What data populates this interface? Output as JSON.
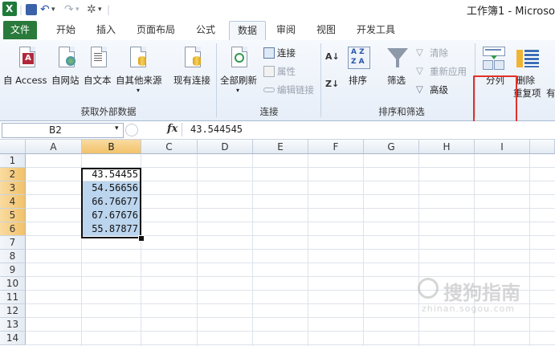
{
  "window": {
    "title": "工作簿1 - Microso"
  },
  "qat": {
    "undo": "↶",
    "redo": "↷",
    "dropdown": "▾"
  },
  "tabs": [
    {
      "label": "文件"
    },
    {
      "label": "开始"
    },
    {
      "label": "插入"
    },
    {
      "label": "页面布局"
    },
    {
      "label": "公式"
    },
    {
      "label": "数据"
    },
    {
      "label": "审阅"
    },
    {
      "label": "视图"
    },
    {
      "label": "开发工具"
    }
  ],
  "ribbon": {
    "external": {
      "access": "自 Access",
      "web": "自网站",
      "text": "自文本",
      "other": "自其他来源",
      "existing": "现有连接",
      "group": "获取外部数据"
    },
    "connections": {
      "refresh_all": "全部刷新",
      "connections": "连接",
      "properties": "属性",
      "edit_links": "编辑链接",
      "group": "连接"
    },
    "sort_filter": {
      "sort": "排序",
      "filter": "筛选",
      "clear": "清除",
      "reapply": "重新应用",
      "advanced": "高级",
      "group": "排序和筛选"
    },
    "data_tools": {
      "text_to_columns": "分列",
      "remove_dup_1": "删除",
      "remove_dup_2": "重复项",
      "extra": "有"
    }
  },
  "formula_bar": {
    "name_box": "B2",
    "fx": "fx",
    "value": "43.544545"
  },
  "sheet": {
    "columns": [
      "A",
      "B",
      "C",
      "D",
      "E",
      "F",
      "G",
      "H",
      "I"
    ],
    "rows": [
      "1",
      "2",
      "3",
      "4",
      "5",
      "6",
      "7",
      "8",
      "9",
      "10",
      "11",
      "12",
      "13",
      "14"
    ],
    "b_values": [
      "43.54455",
      "54.56656",
      "66.76677",
      "67.67676",
      "55.87877"
    ]
  },
  "watermark": {
    "text": "搜狗指南",
    "sub": "zhinan.sogou.com"
  },
  "colors": {
    "file_tab": "#2a7a3b",
    "highlight": "#e2312b",
    "selection": "#bcd5ee"
  }
}
